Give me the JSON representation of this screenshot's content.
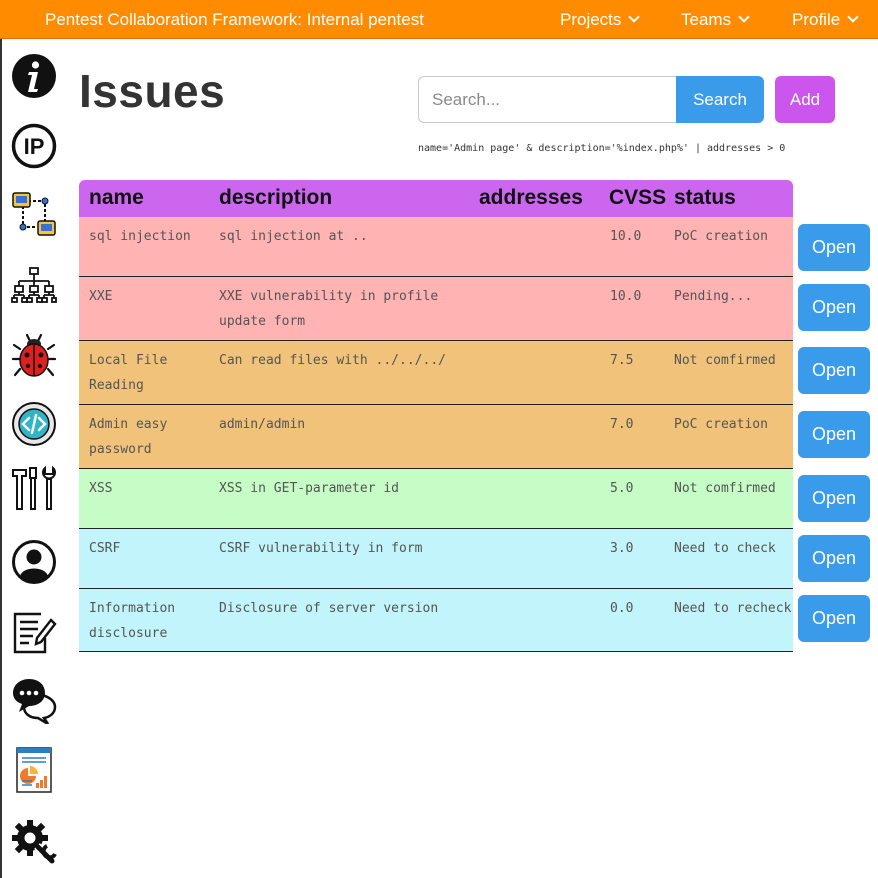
{
  "header": {
    "title": "Pentest Collaboration Framework: Internal pentest",
    "menus": [
      {
        "label": "Projects"
      },
      {
        "label": "Teams"
      },
      {
        "label": "Profile"
      }
    ]
  },
  "sidebar": {
    "items": [
      {
        "icon": "info-icon"
      },
      {
        "icon": "ip-icon"
      },
      {
        "icon": "network-icon"
      },
      {
        "icon": "hierarchy-icon"
      },
      {
        "icon": "bug-icon"
      },
      {
        "icon": "code-icon"
      },
      {
        "icon": "tools-icon"
      },
      {
        "icon": "user-icon"
      },
      {
        "icon": "notes-icon"
      },
      {
        "icon": "chat-icon"
      },
      {
        "icon": "report-icon"
      },
      {
        "icon": "settings-icon"
      }
    ]
  },
  "page": {
    "title": "Issues"
  },
  "search": {
    "placeholder": "Search...",
    "value": "",
    "button_label": "Search",
    "add_label": "Add",
    "hint": "name='Admin page' & description='%index.php%' | addresses > 0"
  },
  "table": {
    "headers": {
      "name": "name",
      "description": "description",
      "addresses": "addresses",
      "cvss": "CVSS",
      "status": "status"
    },
    "open_label": "Open",
    "colors": {
      "header": "#cc66ee",
      "critical": "#ffb3b3",
      "high": "#f0c27a",
      "medium": "#c6fcc6",
      "low": "#c2f4fb"
    },
    "rows": [
      {
        "name": "sql injection",
        "description": "sql injection at ..",
        "addresses": "",
        "cvss": "10.0",
        "status": "PoC creation",
        "severity": "critical"
      },
      {
        "name": "XXE",
        "description": "XXE vulnerability in profile update form",
        "addresses": "",
        "cvss": "10.0",
        "status": "Pending...",
        "severity": "critical"
      },
      {
        "name": "Local File Reading",
        "description": "Can read files with ../../../",
        "addresses": "",
        "cvss": "7.5",
        "status": "Not comfirmed",
        "severity": "high"
      },
      {
        "name": "Admin easy password",
        "description": "admin/admin",
        "addresses": "",
        "cvss": "7.0",
        "status": "PoC creation",
        "severity": "high"
      },
      {
        "name": "XSS",
        "description": "XSS in GET-parameter id",
        "addresses": "",
        "cvss": "5.0",
        "status": "Not comfirmed",
        "severity": "medium"
      },
      {
        "name": "CSRF",
        "description": "CSRF vulnerability in form",
        "addresses": "",
        "cvss": "3.0",
        "status": "Need to check",
        "severity": "low"
      },
      {
        "name": "Information disclosure",
        "description": "Disclosure of server version",
        "addresses": "",
        "cvss": "0.0",
        "status": "Need to recheck",
        "severity": "low"
      }
    ]
  }
}
